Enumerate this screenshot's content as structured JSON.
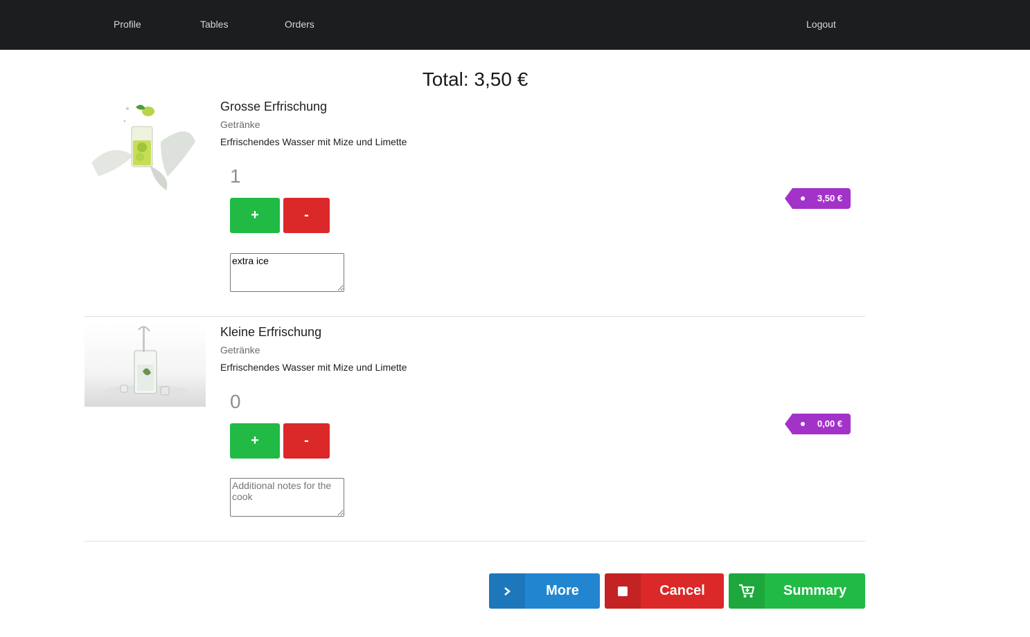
{
  "nav": {
    "profile": "Profile",
    "tables": "Tables",
    "orders": "Orders",
    "logout": "Logout"
  },
  "total_label": "Total: 3,50 €",
  "items": [
    {
      "name": "Grosse Erfrischung",
      "category": "Getränke",
      "description": "Erfrischendes Wasser mit Mize und Limette",
      "quantity": "1",
      "plus_label": "+",
      "minus_label": "-",
      "notes_value": "extra ice",
      "notes_placeholder": "Additional notes for the cook",
      "price": "3,50 €"
    },
    {
      "name": "Kleine Erfrischung",
      "category": "Getränke",
      "description": "Erfrischendes Wasser mit Mize und Limette",
      "quantity": "0",
      "plus_label": "+",
      "minus_label": "-",
      "notes_value": "",
      "notes_placeholder": "Additional notes for the cook",
      "price": "0,00 €"
    }
  ],
  "actions": {
    "more": "More",
    "cancel": "Cancel",
    "summary": "Summary"
  },
  "colors": {
    "topbar": "#1c1d1f",
    "green": "#21ba45",
    "red": "#db2828",
    "blue": "#2185d0",
    "purple": "#a333c8"
  },
  "icons": {
    "more": "chevron-right-icon",
    "cancel": "stop-icon",
    "summary": "cart-plus-icon"
  }
}
